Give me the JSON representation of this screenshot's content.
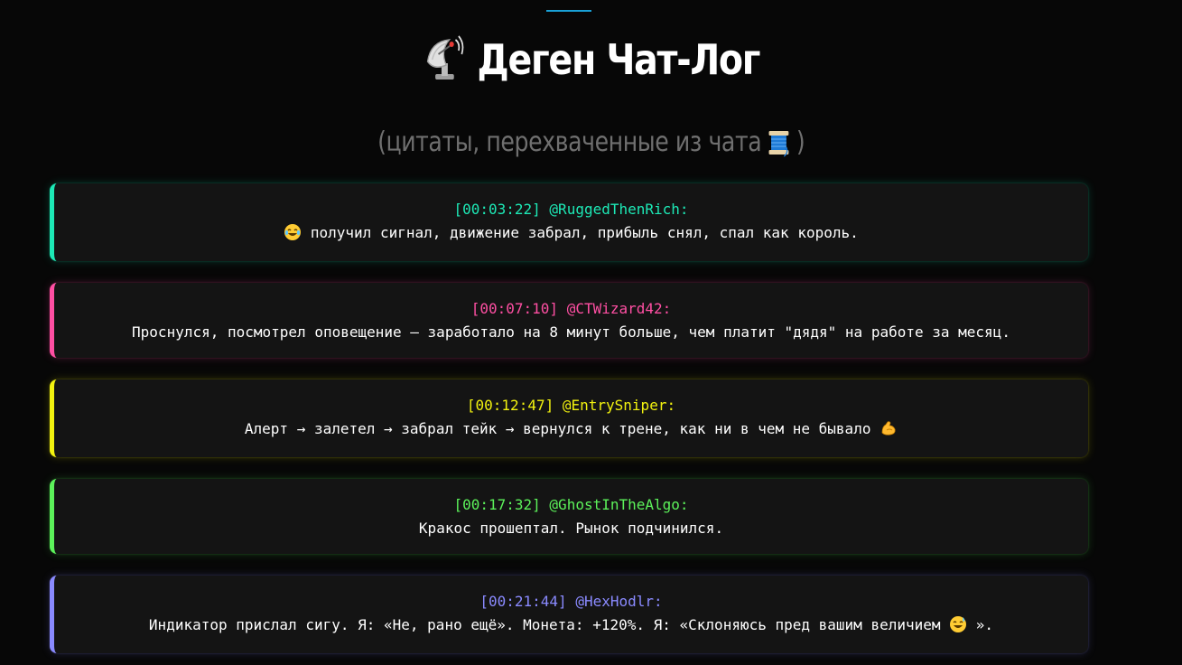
{
  "page": {
    "title": "Деген Чат-Лог",
    "subtitle_text": "(цитаты, перехваченные из чата",
    "subtitle_close": ")",
    "title_icon": "satellite-antenna-icon",
    "subtitle_icon": "thread-spool-icon"
  },
  "colors": {
    "background": "#070707",
    "card": "#141414",
    "accent_top": "#19a0d6"
  },
  "messages": [
    {
      "time": "[00:03:22]",
      "user": "@RuggedThenRich:",
      "emoji_before": "laughing-tears-emoji",
      "text": "получил сигнал, движение забрал, прибыль снял, спал как король.",
      "color": "#1de9b6"
    },
    {
      "time": "[00:07:10]",
      "user": "@CTWizard42:",
      "text": "Проснулся, посмотрел оповещение — заработало на 8 минут больше, чем платит \"дядя\" на работе за месяц.",
      "color": "#ff4fa3"
    },
    {
      "time": "[00:12:47]",
      "user": "@EntrySniper:",
      "text": "Алерт → залетел → забрал тейк → вернулся к трене, как ни в чем не бывало",
      "emoji_after": "flexed-biceps-emoji",
      "color": "#f2f20f"
    },
    {
      "time": "[00:17:32]",
      "user": "@GhostInTheAlgo:",
      "text": "Кракос прошептал. Рынок подчинился.",
      "color": "#5cf25a"
    },
    {
      "time": "[00:21:44]",
      "user": "@HexHodlr:",
      "text_before": "Индикатор прислал сигу. Я: «Не, рано ещё». Монета: +120%. Я: «Склоняюсь пред вашим величием",
      "emoji_mid": "sweat-smile-emoji",
      "text_after": "».",
      "color": "#8a8aff"
    }
  ]
}
